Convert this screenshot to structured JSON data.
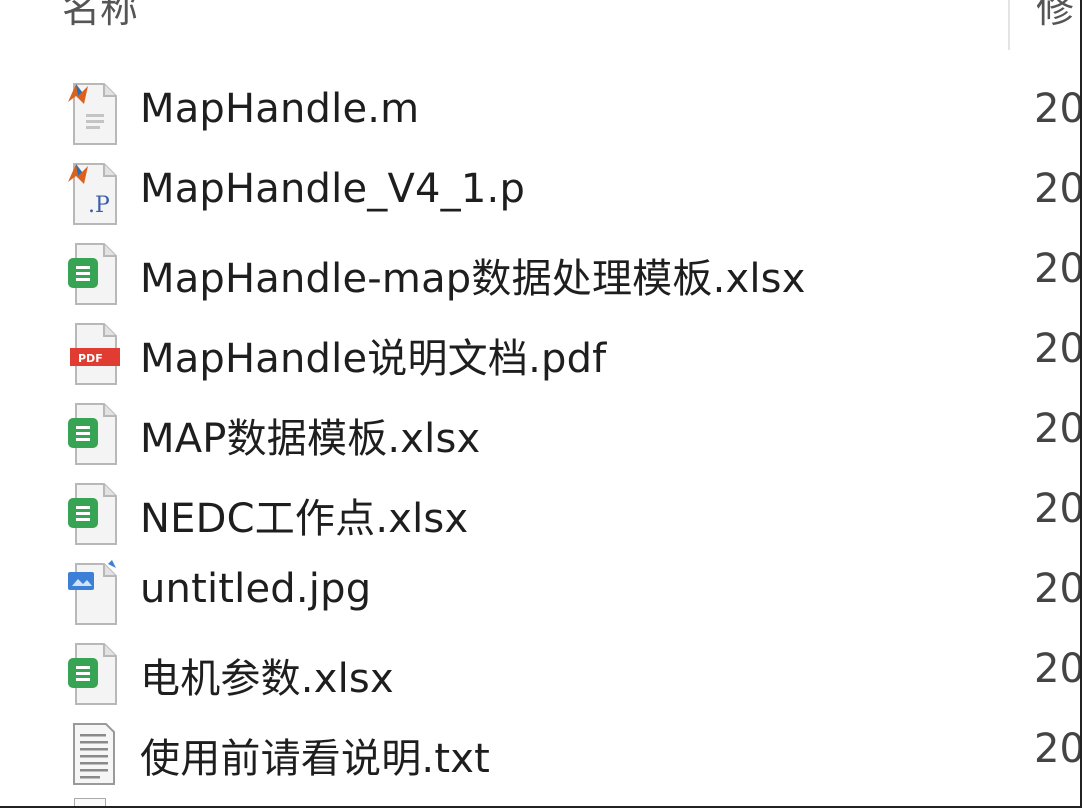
{
  "header": {
    "name_column": "名称",
    "modified_column": "修"
  },
  "files": [
    {
      "name": "MapHandle.m",
      "date": "20",
      "icon": "matlab-m-file-icon"
    },
    {
      "name": "MapHandle_V4_1.p",
      "date": "20",
      "icon": "matlab-p-file-icon"
    },
    {
      "name": "MapHandle-map数据处理模板.xlsx",
      "date": "20",
      "icon": "spreadsheet-icon"
    },
    {
      "name": "MapHandle说明文档.pdf",
      "date": "20",
      "icon": "pdf-icon"
    },
    {
      "name": "MAP数据模板.xlsx",
      "date": "20",
      "icon": "spreadsheet-icon"
    },
    {
      "name": "NEDC工作点.xlsx",
      "date": "20",
      "icon": "spreadsheet-icon"
    },
    {
      "name": "untitled.jpg",
      "date": "20",
      "icon": "image-file-icon"
    },
    {
      "name": "电机参数.xlsx",
      "date": "20",
      "icon": "spreadsheet-icon"
    },
    {
      "name": "使用前请看说明.txt",
      "date": "20",
      "icon": "text-file-icon"
    }
  ],
  "colors": {
    "spreadsheet_green": "#36a452",
    "pdf_red": "#e03c32",
    "matlab_orange": "#d9631e",
    "image_blue": "#3b7fd6"
  }
}
